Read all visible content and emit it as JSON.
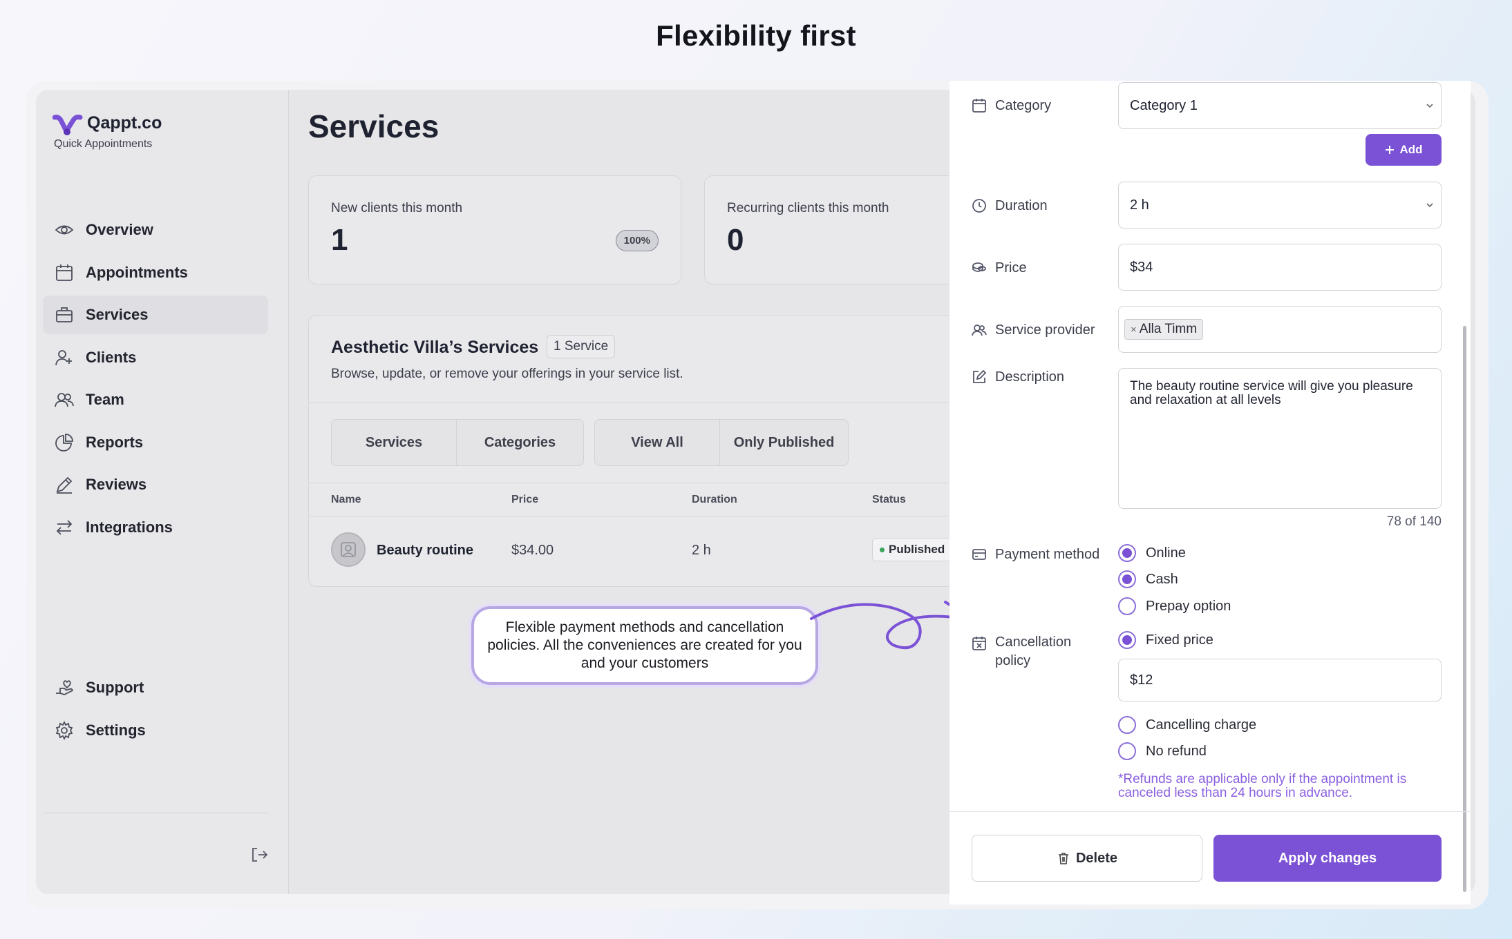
{
  "headline": "Flexibility first",
  "brand": {
    "name": "Qappt.co",
    "tagline": "Quick Appointments"
  },
  "sidebar": {
    "items": [
      {
        "label": "Overview",
        "icon": "eye-icon"
      },
      {
        "label": "Appointments",
        "icon": "calendar-icon"
      },
      {
        "label": "Services",
        "icon": "briefcase-icon",
        "active": true
      },
      {
        "label": "Clients",
        "icon": "user-plus-icon"
      },
      {
        "label": "Team",
        "icon": "users-icon"
      },
      {
        "label": "Reports",
        "icon": "chart-pie-icon"
      },
      {
        "label": "Reviews",
        "icon": "pencil-icon"
      },
      {
        "label": "Integrations",
        "icon": "arrows-icon"
      }
    ],
    "bottom_items": [
      {
        "label": "Support",
        "icon": "hand-heart-icon"
      },
      {
        "label": "Settings",
        "icon": "gear-icon"
      }
    ]
  },
  "main": {
    "title": "Services",
    "stats": [
      {
        "label": "New clients this month",
        "value": "1",
        "badge": "100%"
      },
      {
        "label": "Recurring clients this month",
        "value": "0"
      }
    ],
    "services_card": {
      "title": "Aesthetic Villa’s Services",
      "count": "1 Service",
      "subtitle": "Browse, update, or remove your offerings in your service list.",
      "tabs_group1": [
        "Services",
        "Categories"
      ],
      "tabs_group2": [
        "View All",
        "Only Published"
      ],
      "columns": [
        "Name",
        "Price",
        "Duration",
        "Status"
      ],
      "rows": [
        {
          "name": "Beauty routine",
          "price": "$34.00",
          "duration": "2 h",
          "status": "Published"
        }
      ]
    }
  },
  "callout": "Flexible payment methods and cancellation policies. All the conveniences are created for you and your customers",
  "panel": {
    "category": {
      "label": "Category",
      "value": "Category 1",
      "add_label": "Add"
    },
    "duration": {
      "label": "Duration",
      "value": "2 h"
    },
    "price": {
      "label": "Price",
      "value": "$34"
    },
    "provider": {
      "label": "Service provider",
      "chip": "Alla Timm"
    },
    "description": {
      "label": "Description",
      "value": "The beauty routine service will give you pleasure and relaxation at all levels",
      "counter": "78 of 140"
    },
    "payment": {
      "label": "Payment method",
      "options": [
        {
          "label": "Online",
          "checked": true
        },
        {
          "label": "Cash",
          "checked": true
        },
        {
          "label": "Prepay option",
          "checked": false
        }
      ]
    },
    "cancellation": {
      "label": "Cancellation policy",
      "fixed_label": "Fixed price",
      "fixed_checked": true,
      "fixed_value": "$12",
      "options": [
        {
          "label": "Cancelling charge",
          "checked": false
        },
        {
          "label": "No refund",
          "checked": false
        }
      ],
      "note": "*Refunds are applicable only if the appointment is canceled less than 24 hours in advance."
    },
    "delete_label": "Delete",
    "apply_label": "Apply changes"
  },
  "colors": {
    "accent": "#7b52d6",
    "accent_light": "#b7a7e3",
    "published": "#3aa55d"
  }
}
